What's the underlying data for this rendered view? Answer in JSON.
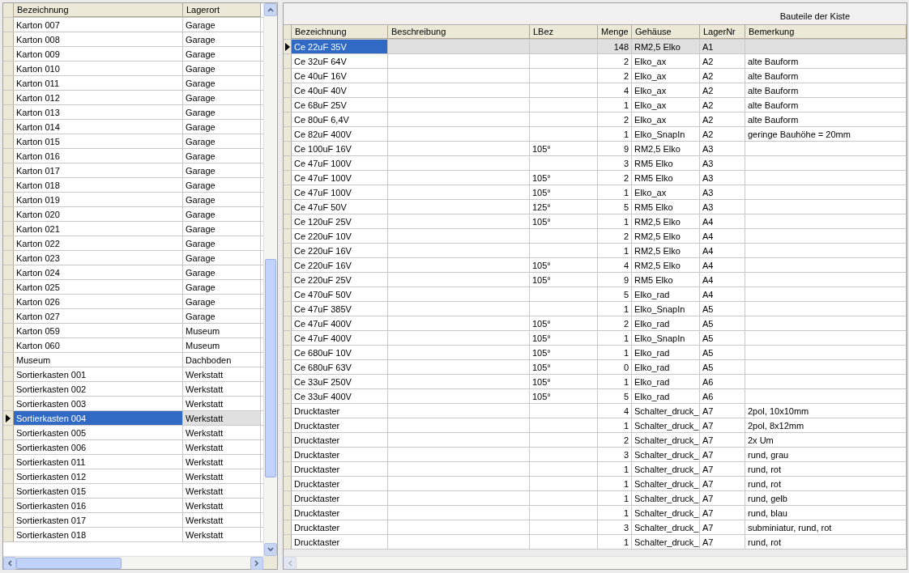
{
  "left_grid": {
    "columns": [
      "Bezeichnung",
      "Lagerort"
    ],
    "rows": [
      {
        "name": "Karton 007",
        "place": "Garage",
        "selected": false
      },
      {
        "name": "Karton 008",
        "place": "Garage",
        "selected": false
      },
      {
        "name": "Karton 009",
        "place": "Garage",
        "selected": false
      },
      {
        "name": "Karton 010",
        "place": "Garage",
        "selected": false
      },
      {
        "name": "Karton 011",
        "place": "Garage",
        "selected": false
      },
      {
        "name": "Karton 012",
        "place": "Garage",
        "selected": false
      },
      {
        "name": "Karton 013",
        "place": "Garage",
        "selected": false
      },
      {
        "name": "Karton 014",
        "place": "Garage",
        "selected": false
      },
      {
        "name": "Karton 015",
        "place": "Garage",
        "selected": false
      },
      {
        "name": "Karton 016",
        "place": "Garage",
        "selected": false
      },
      {
        "name": "Karton 017",
        "place": "Garage",
        "selected": false
      },
      {
        "name": "Karton 018",
        "place": "Garage",
        "selected": false
      },
      {
        "name": "Karton 019",
        "place": "Garage",
        "selected": false
      },
      {
        "name": "Karton 020",
        "place": "Garage",
        "selected": false
      },
      {
        "name": "Karton 021",
        "place": "Garage",
        "selected": false
      },
      {
        "name": "Karton 022",
        "place": "Garage",
        "selected": false
      },
      {
        "name": "Karton 023",
        "place": "Garage",
        "selected": false
      },
      {
        "name": "Karton 024",
        "place": "Garage",
        "selected": false
      },
      {
        "name": "Karton 025",
        "place": "Garage",
        "selected": false
      },
      {
        "name": "Karton 026",
        "place": "Garage",
        "selected": false
      },
      {
        "name": "Karton 027",
        "place": "Garage",
        "selected": false
      },
      {
        "name": "Karton 059",
        "place": "Museum",
        "selected": false
      },
      {
        "name": "Karton 060",
        "place": "Museum",
        "selected": false
      },
      {
        "name": "Museum",
        "place": "Dachboden",
        "selected": false
      },
      {
        "name": "Sortierkasten 001",
        "place": "Werkstatt",
        "selected": false
      },
      {
        "name": "Sortierkasten 002",
        "place": "Werkstatt",
        "selected": false
      },
      {
        "name": "Sortierkasten 003",
        "place": "Werkstatt",
        "selected": false
      },
      {
        "name": "Sortierkasten 004",
        "place": "Werkstatt",
        "selected": true
      },
      {
        "name": "Sortierkasten 005",
        "place": "Werkstatt",
        "selected": false
      },
      {
        "name": "Sortierkasten 006",
        "place": "Werkstatt",
        "selected": false
      },
      {
        "name": "Sortierkasten 011",
        "place": "Werkstatt",
        "selected": false
      },
      {
        "name": "Sortierkasten 012",
        "place": "Werkstatt",
        "selected": false
      },
      {
        "name": "Sortierkasten 015",
        "place": "Werkstatt",
        "selected": false
      },
      {
        "name": "Sortierkasten 016",
        "place": "Werkstatt",
        "selected": false
      },
      {
        "name": "Sortierkasten 017",
        "place": "Werkstatt",
        "selected": false
      },
      {
        "name": "Sortierkasten 018",
        "place": "Werkstatt",
        "selected": false
      }
    ]
  },
  "right_grid": {
    "title": "Bauteile der Kiste",
    "columns": [
      "Bezeichnung",
      "Beschreibung",
      "LBez",
      "Menge",
      "Gehäuse",
      "LagerNr",
      "Bemerkung"
    ],
    "rows": [
      {
        "bez": "Ce 22uF 35V",
        "menge": "148",
        "geh": "RM2,5 Elko",
        "lager": "A1",
        "selected": true
      },
      {
        "bez": "Ce 32uF 64V",
        "menge": "2",
        "geh": "Elko_ax",
        "lager": "A2",
        "bem": "alte Bauform",
        "selected": false
      },
      {
        "bez": "Ce 40uF 16V",
        "menge": "2",
        "geh": "Elko_ax",
        "lager": "A2",
        "bem": "alte Bauform",
        "selected": false
      },
      {
        "bez": "Ce 40uF 40V",
        "menge": "4",
        "geh": "Elko_ax",
        "lager": "A2",
        "bem": "alte Bauform",
        "selected": false
      },
      {
        "bez": "Ce 68uF 25V",
        "menge": "1",
        "geh": "Elko_ax",
        "lager": "A2",
        "bem": "alte Bauform",
        "selected": false
      },
      {
        "bez": "Ce 80uF 6,4V",
        "menge": "2",
        "geh": "Elko_ax",
        "lager": "A2",
        "bem": "alte Bauform",
        "selected": false
      },
      {
        "bez": "Ce 82uF 400V",
        "menge": "1",
        "geh": "Elko_SnapIn",
        "lager": "A2",
        "bem": "geringe Bauhöhe = 20mm",
        "selected": false
      },
      {
        "bez": "Ce 100uF 16V",
        "lbez": "105°",
        "menge": "9",
        "geh": "RM2,5 Elko",
        "lager": "A3",
        "selected": false
      },
      {
        "bez": "Ce 47uF 100V",
        "menge": "3",
        "geh": "RM5 Elko",
        "lager": "A3",
        "selected": false
      },
      {
        "bez": "Ce 47uF 100V",
        "lbez": "105°",
        "menge": "2",
        "geh": "RM5 Elko",
        "lager": "A3",
        "selected": false
      },
      {
        "bez": "Ce 47uF 100V",
        "lbez": "105°",
        "menge": "1",
        "geh": "Elko_ax",
        "lager": "A3",
        "selected": false
      },
      {
        "bez": "Ce 47uF 50V",
        "lbez": "125°",
        "menge": "5",
        "geh": "RM5 Elko",
        "lager": "A3",
        "selected": false
      },
      {
        "bez": "Ce 120uF 25V",
        "lbez": "105°",
        "menge": "1",
        "geh": "RM2,5 Elko",
        "lager": "A4",
        "selected": false
      },
      {
        "bez": "Ce 220uF 10V",
        "menge": "2",
        "geh": "RM2,5 Elko",
        "lager": "A4",
        "selected": false
      },
      {
        "bez": "Ce 220uF 16V",
        "menge": "1",
        "geh": "RM2,5 Elko",
        "lager": "A4",
        "selected": false
      },
      {
        "bez": "Ce 220uF 16V",
        "lbez": "105°",
        "menge": "4",
        "geh": "RM2,5 Elko",
        "lager": "A4",
        "selected": false
      },
      {
        "bez": "Ce 220uF 25V",
        "lbez": "105°",
        "menge": "9",
        "geh": "RM5 Elko",
        "lager": "A4",
        "selected": false
      },
      {
        "bez": "Ce 470uF 50V",
        "menge": "5",
        "geh": "Elko_rad",
        "lager": "A4",
        "selected": false
      },
      {
        "bez": "Ce 47uF 385V",
        "menge": "1",
        "geh": "Elko_SnapIn",
        "lager": "A5",
        "selected": false
      },
      {
        "bez": "Ce 47uF 400V",
        "lbez": "105°",
        "menge": "2",
        "geh": "Elko_rad",
        "lager": "A5",
        "selected": false
      },
      {
        "bez": "Ce 47uF 400V",
        "lbez": "105°",
        "menge": "1",
        "geh": "Elko_SnapIn",
        "lager": "A5",
        "selected": false
      },
      {
        "bez": "Ce 680uF 10V",
        "lbez": "105°",
        "menge": "1",
        "geh": "Elko_rad",
        "lager": "A5",
        "selected": false
      },
      {
        "bez": "Ce 680uF 63V",
        "lbez": "105°",
        "menge": "0",
        "geh": "Elko_rad",
        "lager": "A5",
        "selected": false
      },
      {
        "bez": "Ce 33uF 250V",
        "lbez": "105°",
        "menge": "1",
        "geh": "Elko_rad",
        "lager": "A6",
        "selected": false
      },
      {
        "bez": "Ce 33uF 400V",
        "lbez": "105°",
        "menge": "5",
        "geh": "Elko_rad",
        "lager": "A6",
        "selected": false
      },
      {
        "bez": "Drucktaster",
        "menge": "4",
        "geh": "Schalter_druck_",
        "lager": "A7",
        "bem": "2pol, 10x10mm",
        "selected": false
      },
      {
        "bez": "Drucktaster",
        "menge": "1",
        "geh": "Schalter_druck_",
        "lager": "A7",
        "bem": "2pol, 8x12mm",
        "selected": false
      },
      {
        "bez": "Drucktaster",
        "menge": "2",
        "geh": "Schalter_druck_",
        "lager": "A7",
        "bem": "2x Um",
        "selected": false
      },
      {
        "bez": "Drucktaster",
        "menge": "3",
        "geh": "Schalter_druck_",
        "lager": "A7",
        "bem": "rund, grau",
        "selected": false
      },
      {
        "bez": "Drucktaster",
        "menge": "1",
        "geh": "Schalter_druck_",
        "lager": "A7",
        "bem": "rund, rot",
        "selected": false
      },
      {
        "bez": "Drucktaster",
        "menge": "1",
        "geh": "Schalter_druck_",
        "lager": "A7",
        "bem": "rund, rot",
        "selected": false
      },
      {
        "bez": "Drucktaster",
        "menge": "1",
        "geh": "Schalter_druck_",
        "lager": "A7",
        "bem": "rund, gelb",
        "selected": false
      },
      {
        "bez": "Drucktaster",
        "menge": "1",
        "geh": "Schalter_druck_",
        "lager": "A7",
        "bem": "rund, blau",
        "selected": false
      },
      {
        "bez": "Drucktaster",
        "menge": "3",
        "geh": "Schalter_druck_",
        "lager": "A7",
        "bem": "subminiatur, rund, rot",
        "selected": false
      },
      {
        "bez": "Drucktaster",
        "menge": "1",
        "geh": "Schalter_druck_",
        "lager": "A7",
        "bem": "rund, rot",
        "selected": false
      }
    ]
  }
}
